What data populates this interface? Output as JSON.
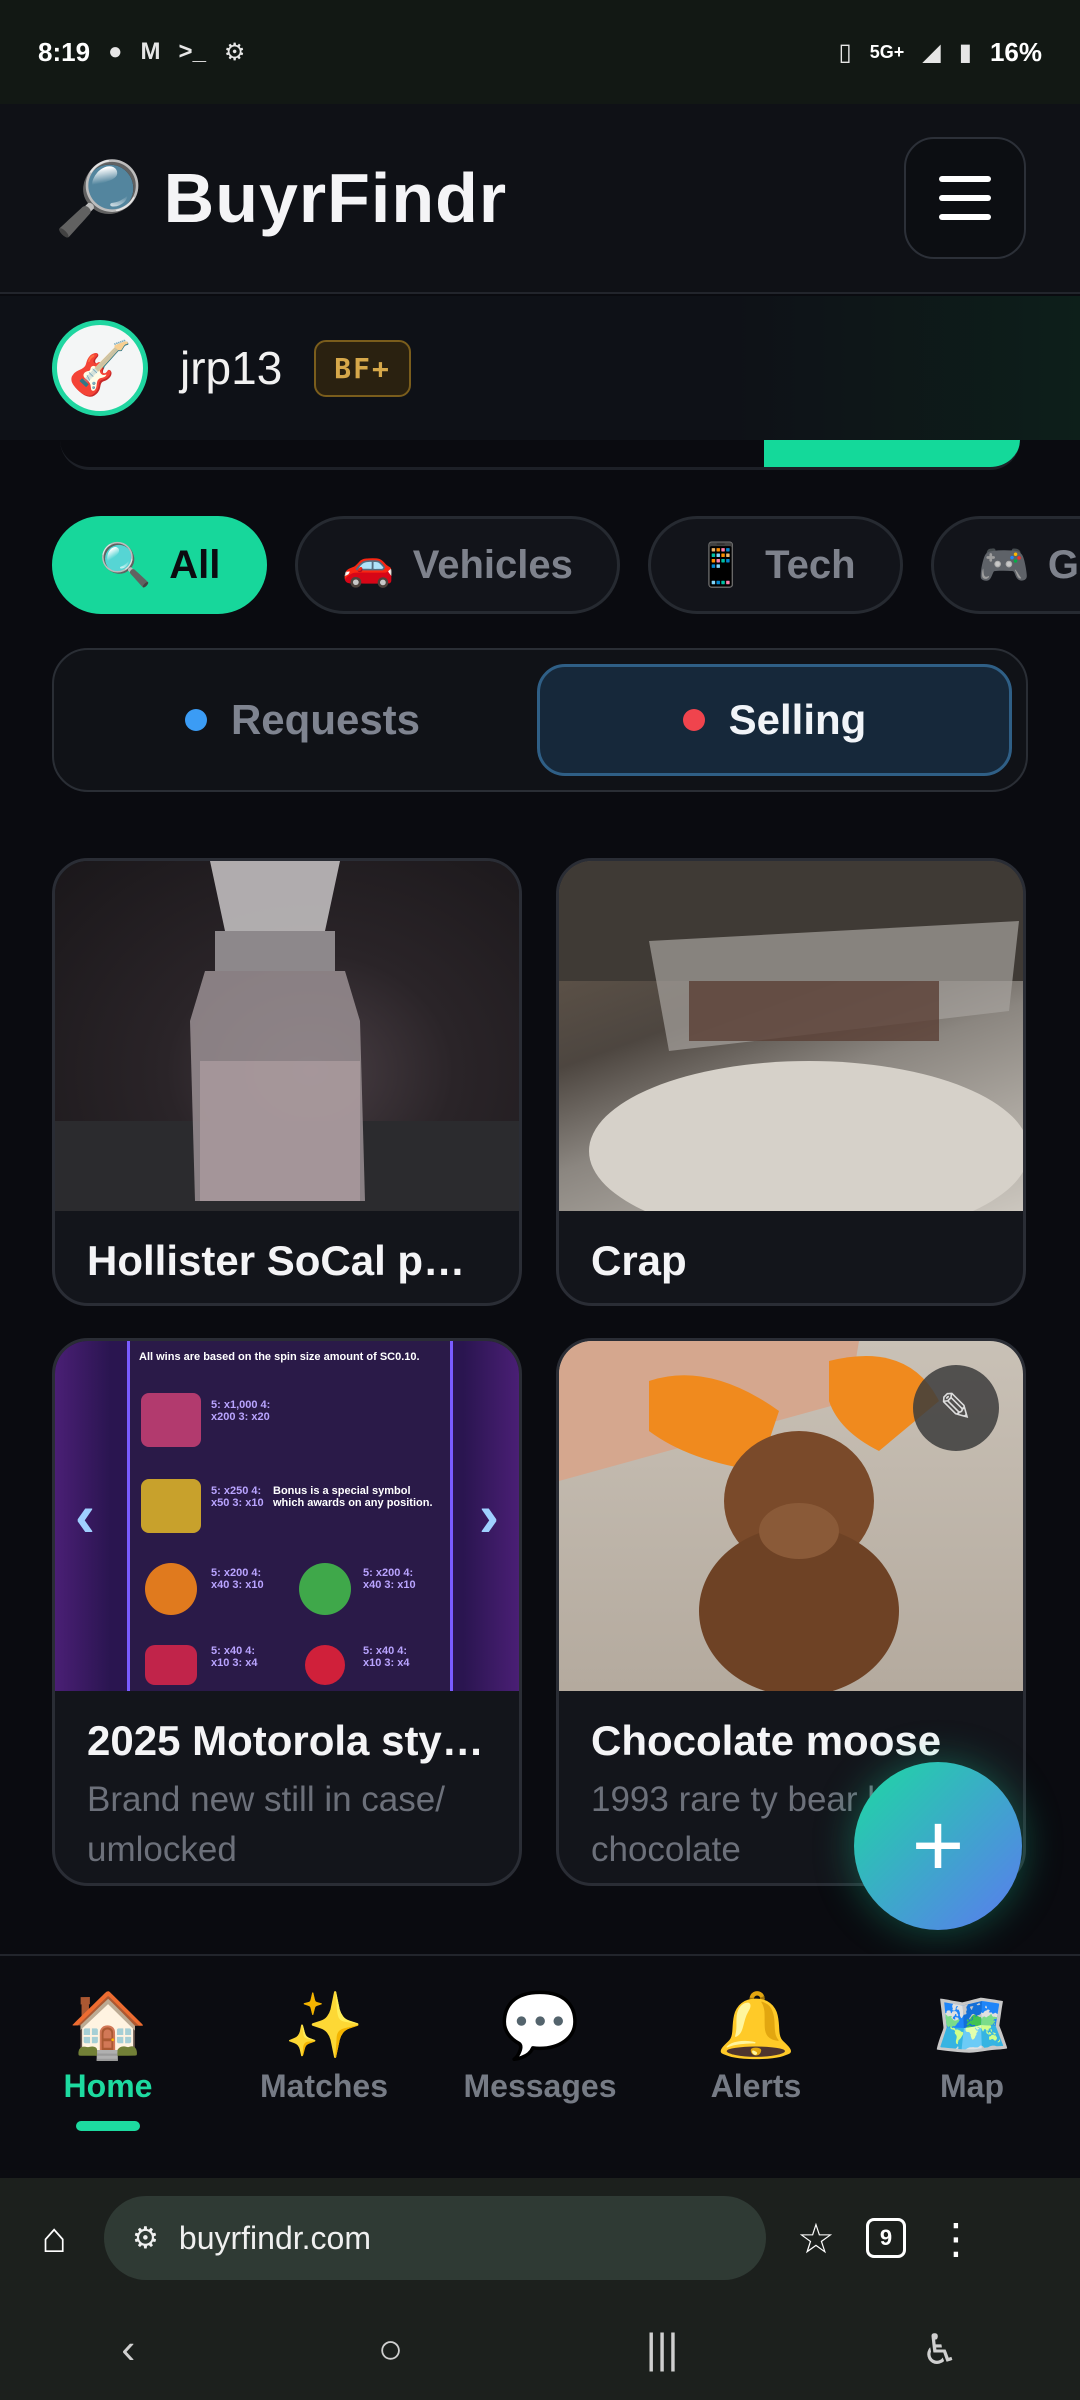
{
  "status_bar": {
    "time": "8:19",
    "left_icons": [
      "reddit-icon",
      "gmail-icon",
      "terminal-icon",
      "bug-icon"
    ],
    "network": "5G+",
    "battery": "16%"
  },
  "header": {
    "brand_glyph": "🔎",
    "brand_name": "BuyrFindr"
  },
  "user": {
    "avatar_glyph": "🎸",
    "username": "jrp13",
    "badge": "BF+"
  },
  "categories": [
    {
      "emoji": "🔍",
      "label": "All",
      "active": true
    },
    {
      "emoji": "🚗",
      "label": "Vehicles",
      "active": false
    },
    {
      "emoji": "📱",
      "label": "Tech",
      "active": false
    },
    {
      "emoji": "🎮",
      "label": "Ga",
      "active": false
    }
  ],
  "segment": {
    "requests_label": "Requests",
    "selling_label": "Selling",
    "requests_dot_color": "#3b9cf5",
    "selling_dot_color": "#f0444d",
    "active": "Selling"
  },
  "listings": [
    {
      "title": "Hollister SoCal pe…",
      "desc": ""
    },
    {
      "title": "Crap",
      "desc": ""
    },
    {
      "title": "2025 Motorola sty…",
      "desc": "Brand new still in case/ umlocked",
      "image_text": {
        "header": "All wins are based on the spin size amount of SC0.10.",
        "joker": "5: x1,000 4: x200 3: x20",
        "bonus": "5: x250 4: x50 3: x10",
        "bonus_note": "Bonus is a special symbol which awards on any position.",
        "row3a": "5: x200 4: x40 3: x10",
        "row3b": "5: x200 4: x40 3: x10",
        "row4a": "5: x40 4: x10 3: x4",
        "row4b": "5: x40 4: x10 3: x4"
      }
    },
    {
      "title": "Chocolate moose",
      "desc": "1993 rare ty bear baby chocolate"
    }
  ],
  "fab": {
    "label": "+"
  },
  "bottom_nav": [
    {
      "emoji": "🏠",
      "label": "Home",
      "active": true
    },
    {
      "emoji": "✨",
      "label": "Matches",
      "active": false
    },
    {
      "emoji": "💬",
      "label": "Messages",
      "active": false
    },
    {
      "emoji": "🔔",
      "label": "Alerts",
      "active": false
    },
    {
      "emoji": "🗺️",
      "label": "Map",
      "active": false
    }
  ],
  "browser": {
    "url": "buyrfindr.com",
    "tab_count": "9"
  },
  "colors": {
    "accent": "#17d79b",
    "background": "#0a0b10",
    "fab_gradient_end": "#5b7af0"
  }
}
